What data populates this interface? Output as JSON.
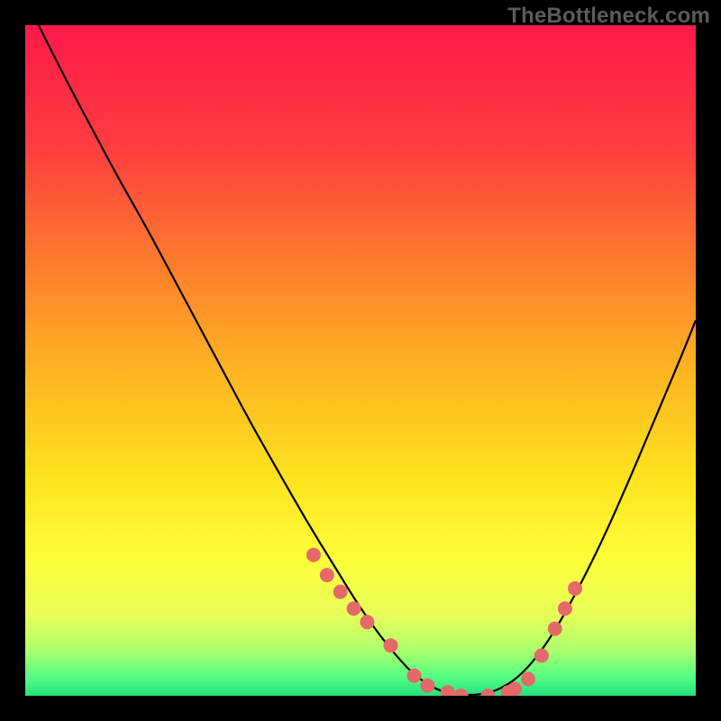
{
  "watermark_text": "TheBottleneck.com",
  "chart_data": {
    "type": "line",
    "title": "",
    "xlabel": "",
    "ylabel": "",
    "xlim": [
      0,
      100
    ],
    "ylim": [
      0,
      100
    ],
    "background_gradient": {
      "stops": [
        {
          "offset": 0.0,
          "color": "#ff1a4b"
        },
        {
          "offset": 0.18,
          "color": "#ff3c3f"
        },
        {
          "offset": 0.35,
          "color": "#ff7a2e"
        },
        {
          "offset": 0.52,
          "color": "#ffb621"
        },
        {
          "offset": 0.68,
          "color": "#ffe41e"
        },
        {
          "offset": 0.8,
          "color": "#fdff3a"
        },
        {
          "offset": 0.88,
          "color": "#e7ff59"
        },
        {
          "offset": 0.93,
          "color": "#afff6b"
        },
        {
          "offset": 0.97,
          "color": "#58ff82"
        },
        {
          "offset": 1.0,
          "color": "#23e27e"
        }
      ]
    },
    "series": [
      {
        "name": "bottleneck-curve",
        "color": "#000000",
        "x": [
          2,
          6,
          10,
          14,
          18,
          22,
          26,
          30,
          34,
          38,
          42,
          46,
          50,
          54,
          58,
          62,
          66,
          70,
          74,
          78,
          82,
          86,
          90,
          94,
          98,
          100
        ],
        "y": [
          100,
          92,
          84.5,
          77,
          70,
          62.5,
          55,
          47.5,
          40,
          33,
          26,
          19.5,
          13,
          7.5,
          3,
          0.5,
          0,
          0.5,
          3,
          8,
          15,
          23,
          32,
          41.5,
          51,
          56
        ]
      }
    ],
    "markers": {
      "name": "highlight-points",
      "color": "#e46a6a",
      "radius": 8,
      "x": [
        43,
        45,
        47,
        49,
        51,
        54.5,
        58,
        60,
        63,
        65,
        69,
        72,
        73,
        75,
        77,
        79,
        80.5,
        82
      ],
      "y": [
        21,
        18,
        15.5,
        13,
        11,
        7.5,
        3,
        1.5,
        0.5,
        0,
        0,
        0.5,
        1,
        2.5,
        6,
        10,
        13,
        16
      ]
    }
  }
}
